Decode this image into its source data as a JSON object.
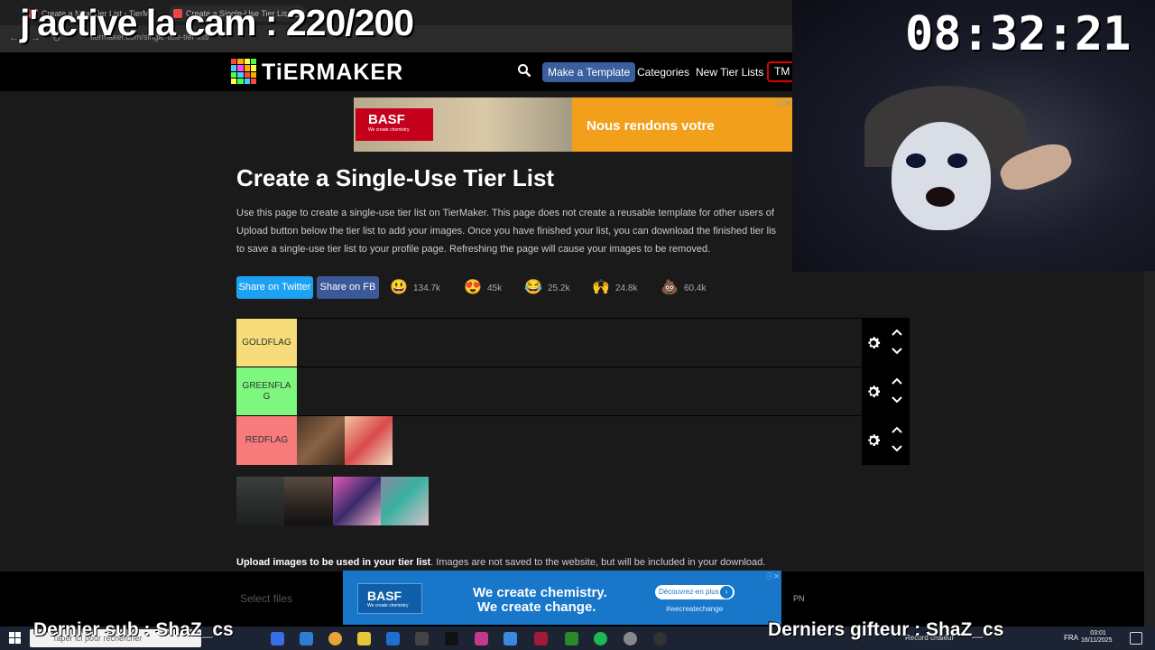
{
  "overlay": {
    "title": "j'active la cam : 220/200",
    "clock": "08:32:21",
    "last_sub": "Dernier sub : ShaZ_cs",
    "last_gifter": "Derniers gifteur : ShaZ_cs"
  },
  "browser": {
    "tab1_title": "Create a New Tier List - TierM...",
    "tab2_title": "Create a Single-Use Tier List @...",
    "url": "tiermaker.com/single-use-tier-list/"
  },
  "header": {
    "logo_text": "TiERMAKER",
    "make_template": "Make a Template",
    "categories": "Categories",
    "new_tier_lists": "New Tier Lists",
    "tm": "TM",
    "logo_colors": [
      "#f44",
      "#fa0",
      "#ff4",
      "#4f4",
      "#4cf",
      "#f4f",
      "#fa0",
      "#ff4",
      "#4f4",
      "#4cf",
      "#f44",
      "#fa0",
      "#ff4",
      "#4f4",
      "#4cf",
      "#f44"
    ]
  },
  "ad_top": {
    "brand": "BASF",
    "brand_tag": "We create chemistry",
    "text": "Nous rendons votre"
  },
  "content": {
    "title": "Create a Single-Use Tier List",
    "intro_1": "Use this page to create a single-use tier list on TierMaker. This page does not create a reusable template for other users of",
    "intro_2": "Upload button below the tier list to add your images. Once you have finished your list, you can download the finished tier lis",
    "intro_3": "to save a single-use tier list to your profile page. Refreshing the page will cause your images to be removed.",
    "share_twitter": "Share on Twitter",
    "share_fb": "Share on FB",
    "reactions": [
      {
        "emoji": "😃",
        "count": "134.7k"
      },
      {
        "emoji": "😍",
        "count": "45k"
      },
      {
        "emoji": "😂",
        "count": "25.2k"
      },
      {
        "emoji": "🙌",
        "count": "24.8k"
      },
      {
        "emoji": "💩",
        "count": "60.4k"
      }
    ],
    "upload_bold": "Upload images to be used in your tier list",
    "upload_rest": ". Images are not saved to the website, but will be included in your download.",
    "select_files": "Select files",
    "pn": "PN"
  },
  "tiers": [
    {
      "label": "GOLDFLAG",
      "color": "#f6dc7a"
    },
    {
      "label": "GREENFLAG",
      "color": "#7df77d"
    },
    {
      "label": "REDFLAG",
      "color": "#f77b7b"
    }
  ],
  "ad_bottom": {
    "brand": "BASF",
    "brand_tag": "We create chemistry",
    "line1": "We create chemistry.",
    "line2": "We create change.",
    "cta": "Découvrez-en plus",
    "hashtag": "#wecreatechange"
  },
  "taskbar": {
    "search_placeholder": "Taper ici pour rechercher",
    "tray_text": "Record chaleur",
    "lang": "FRA",
    "time": "03:01",
    "date": "16/11/2025"
  }
}
